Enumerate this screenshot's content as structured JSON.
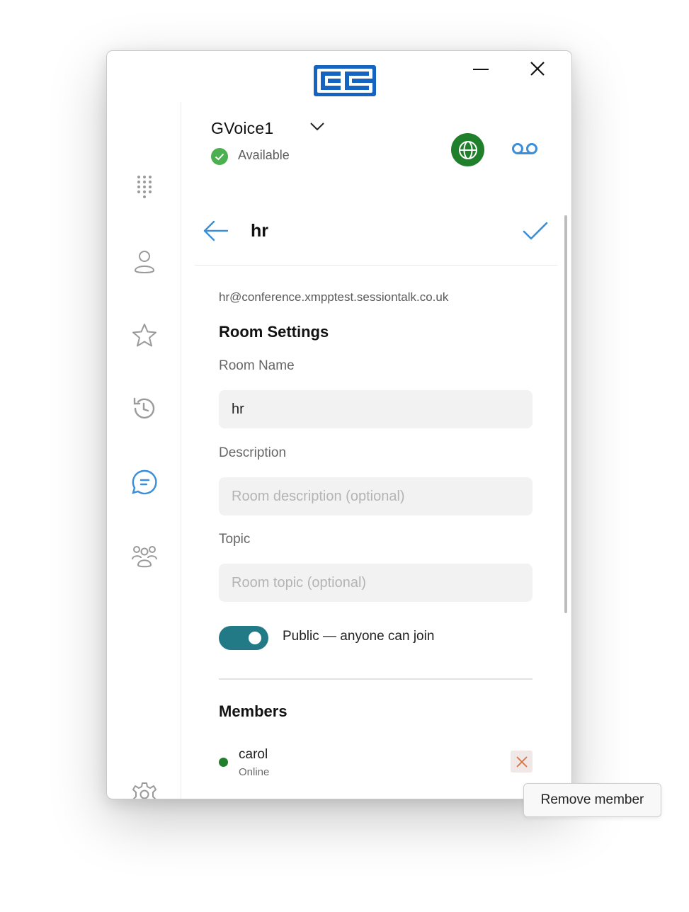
{
  "window": {
    "logo_icon": "cc-logo",
    "minimize_icon": "minimize-icon",
    "close_icon": "close-icon"
  },
  "sidebar": {
    "items": [
      {
        "icon": "dialpad-icon",
        "active": false
      },
      {
        "icon": "contact-icon",
        "active": false
      },
      {
        "icon": "star-icon",
        "active": false
      },
      {
        "icon": "history-icon",
        "active": false
      },
      {
        "icon": "chat-icon",
        "active": true
      },
      {
        "icon": "group-icon",
        "active": false
      }
    ],
    "settings_icon": "gear-icon"
  },
  "account": {
    "name": "GVoice1",
    "status": "Available",
    "status_color": "#4caf50"
  },
  "header": {
    "room_name": "hr"
  },
  "room": {
    "jid": "hr@conference.xmpptest.sessiontalk.co.uk",
    "settings_title": "Room Settings",
    "name_label": "Room Name",
    "name_value": "hr",
    "description_label": "Description",
    "description_placeholder": "Room description (optional)",
    "topic_label": "Topic",
    "topic_placeholder": "Room topic (optional)",
    "public_label": "Public — anyone can join",
    "public_enabled": true,
    "members_title": "Members",
    "members": [
      {
        "name": "carol",
        "status": "Online",
        "status_color": "#1f7f2b"
      }
    ]
  },
  "tooltip": {
    "text": "Remove member"
  },
  "colors": {
    "accent": "#4a9be0",
    "online": "#1f7f2b",
    "toggle": "#227a87",
    "logo_blue": "#1565c0"
  }
}
